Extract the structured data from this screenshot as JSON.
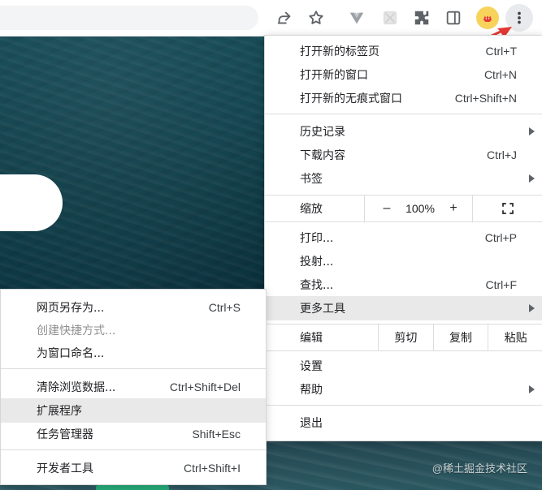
{
  "colors": {
    "accent_red": "#e53935",
    "menu_bg": "#ffffff",
    "menu_highlight": "#e9e9e9",
    "text_primary": "#202124",
    "text_disabled": "#8f8f8f"
  },
  "toolbar": {
    "icons": [
      {
        "name": "share-icon"
      },
      {
        "name": "bookmark-star-icon"
      },
      {
        "name": "vue-devtools-icon"
      },
      {
        "name": "blocked-extension-icon"
      },
      {
        "name": "extensions-puzzle-icon"
      },
      {
        "name": "side-panel-icon"
      },
      {
        "name": "fox-extension-icon"
      },
      {
        "name": "more-menu-kebab-icon"
      }
    ]
  },
  "main_menu": {
    "items_top": [
      {
        "label": "打开新的标签页",
        "shortcut": "Ctrl+T"
      },
      {
        "label": "打开新的窗口",
        "shortcut": "Ctrl+N"
      },
      {
        "label": "打开新的无痕式窗口",
        "shortcut": "Ctrl+Shift+N"
      }
    ],
    "items_mid": [
      {
        "label": "历史记录",
        "has_submenu": true
      },
      {
        "label": "下载内容",
        "shortcut": "Ctrl+J"
      },
      {
        "label": "书签",
        "has_submenu": true
      }
    ],
    "zoom": {
      "label": "缩放",
      "minus": "–",
      "value": "100%",
      "plus": "+"
    },
    "items_tools": [
      {
        "label": "打印...",
        "shortcut": "Ctrl+P"
      },
      {
        "label": "投射..."
      },
      {
        "label": "查找...",
        "shortcut": "Ctrl+F"
      },
      {
        "label": "更多工具",
        "has_submenu": true
      }
    ],
    "edit": {
      "label": "编辑",
      "cut": "剪切",
      "copy": "复制",
      "paste": "粘贴"
    },
    "items_bottom": [
      {
        "label": "设置"
      },
      {
        "label": "帮助",
        "has_submenu": true
      }
    ],
    "exit": {
      "label": "退出"
    }
  },
  "more_tools_submenu": {
    "items": [
      {
        "label": "网页另存为...",
        "shortcut": "Ctrl+S"
      },
      {
        "label": "创建快捷方式...",
        "disabled": true
      },
      {
        "label": "为窗口命名..."
      },
      {
        "label": "清除浏览数据...",
        "shortcut": "Ctrl+Shift+Del"
      },
      {
        "label": "扩展程序",
        "highlighted": true
      },
      {
        "label": "任务管理器",
        "shortcut": "Shift+Esc"
      },
      {
        "label": "开发者工具",
        "shortcut": "Ctrl+Shift+I"
      }
    ]
  },
  "watermark": "@稀土掘金技术社区"
}
